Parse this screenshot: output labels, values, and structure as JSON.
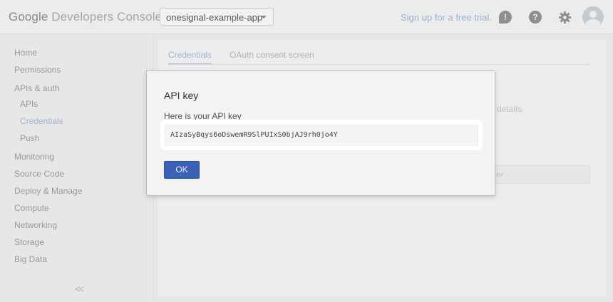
{
  "header": {
    "brand_part1": "Google",
    "brand_part2": "Developers Console",
    "project": "onesignal-example-app",
    "signup_link": "Sign up for a free trial.",
    "feedback_glyph": "!",
    "help_glyph": "?"
  },
  "sidebar": {
    "items": [
      {
        "label": "Home"
      },
      {
        "label": "Permissions"
      },
      {
        "label": "APIs & auth"
      },
      {
        "label": "APIs"
      },
      {
        "label": "Credentials"
      },
      {
        "label": "Push"
      },
      {
        "label": "Monitoring"
      },
      {
        "label": "Source Code"
      },
      {
        "label": "Deploy & Manage"
      },
      {
        "label": "Compute"
      },
      {
        "label": "Networking"
      },
      {
        "label": "Storage"
      },
      {
        "label": "Big Data"
      }
    ],
    "collapse_glyph": "<<"
  },
  "main": {
    "tabs": [
      {
        "label": "Credentials"
      },
      {
        "label": "OAuth consent screen"
      }
    ],
    "background_text": "details.",
    "background_field_text": "er"
  },
  "dialog": {
    "title": "API key",
    "label": "Here is your API key",
    "api_key": "AIzaSyBqys6oDswemR9SlPUIxS0bjAJ9rh0jo4Y",
    "ok_label": "OK"
  },
  "colors": {
    "accent": "#3a63b8",
    "link": "#9cb3d8",
    "highlight": "#ffffff"
  },
  "icons": [
    "feedback-icon",
    "help-icon",
    "gear-icon",
    "avatar-icon",
    "chevron-double-left-icon"
  ]
}
